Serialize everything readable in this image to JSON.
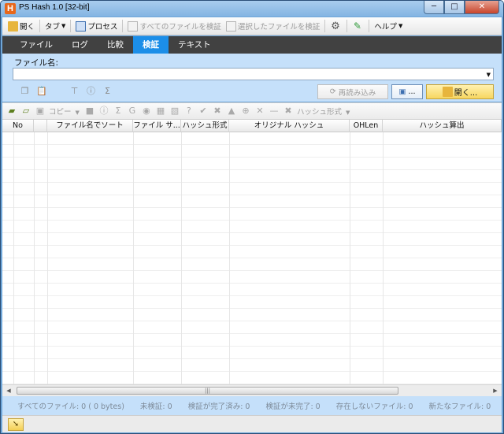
{
  "window": {
    "title": "PS Hash 1.0   [32-bit]",
    "min": "─",
    "max": "□",
    "close": "✕"
  },
  "toolbar": {
    "open": "開く",
    "tabs": "タブ",
    "process": "プロセス",
    "verify_all": "すべてのファイルを検証",
    "verify_selected": "選択したファイルを検証",
    "help": "ヘルプ"
  },
  "tabs": [
    "ファイル",
    "ログ",
    "比較",
    "検証",
    "テキスト"
  ],
  "panel": {
    "file_label": "ファイル名:",
    "file_value": "",
    "reload": "再読み込み",
    "browse": "...",
    "open": "開く..."
  },
  "toolbar2": {
    "copy": "コピー",
    "hash_type": "ハッシュ形式"
  },
  "columns": [
    "No",
    "",
    "ファイル名でソート",
    "ファイル サ...",
    "ハッシュ形式",
    "オリジナル ハッシュ",
    "OHLen",
    "ハッシュ算出"
  ],
  "status": [
    "すべてのファイル: 0  ( 0 bytes)",
    "未検証:  0",
    "検証が完了済み:  0",
    "検証が未完了:  0",
    "存在しないファイル:  0",
    "新たなファイル:  0"
  ],
  "icons": {
    "open": "folder-open-icon",
    "process": "process-icon",
    "settings": "gear-icon",
    "pin": "pin-icon",
    "corner": "arrow-icon"
  },
  "colors": {
    "active_tab": "#1c8ee8",
    "panel": "#c5e0fa",
    "tabbar": "#414141",
    "open_button": "#f7d660"
  }
}
